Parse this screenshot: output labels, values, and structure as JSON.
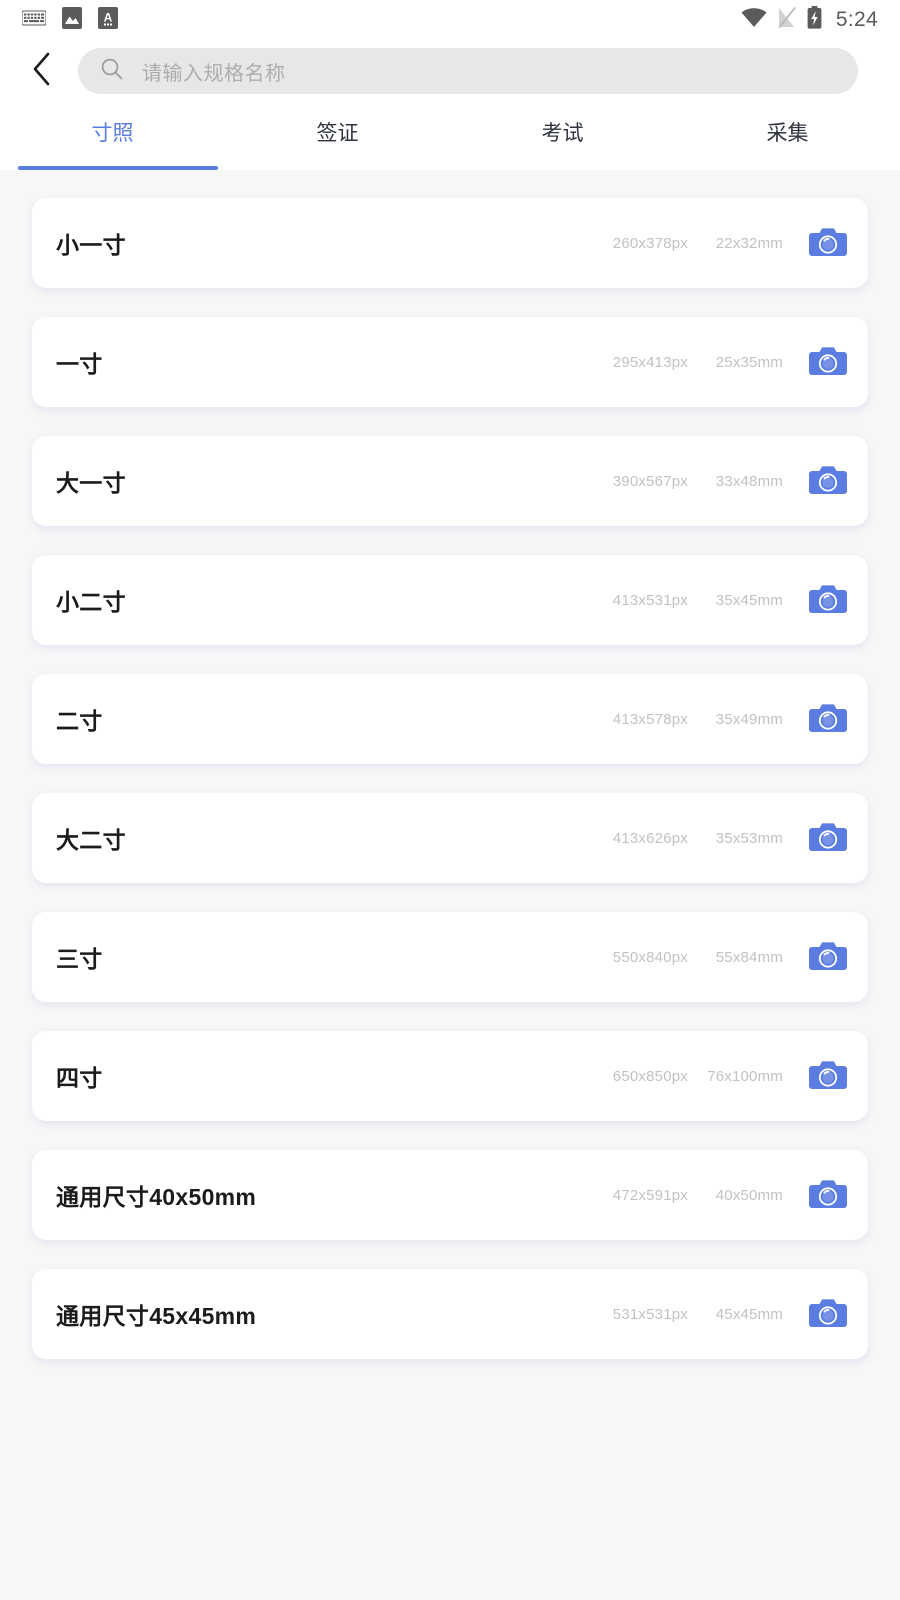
{
  "statusbar": {
    "time": "5:24",
    "left_icons": [
      "keyboard-icon",
      "image-icon",
      "letter-a-icon"
    ],
    "right_icons": [
      "wifi-icon",
      "no-signal-icon",
      "battery-charging-icon"
    ]
  },
  "header": {
    "back_icon": "chevron-left-icon",
    "search": {
      "icon": "search-icon",
      "value": "",
      "placeholder": "请输入规格名称"
    }
  },
  "tabs": {
    "active_index": 0,
    "items": [
      {
        "label": "寸照"
      },
      {
        "label": "签证"
      },
      {
        "label": "考试"
      },
      {
        "label": "采集"
      }
    ]
  },
  "colors": {
    "accent": "#5b7ce0",
    "page_bg": "#f7f7f7",
    "card_bg": "#ffffff",
    "muted_text": "#c2c2c2",
    "search_bg": "#e7e7e7"
  },
  "list": {
    "camera_icon": "camera-icon",
    "items": [
      {
        "name": "小一寸",
        "px": "260x378px",
        "mm": "22x32mm"
      },
      {
        "name": "一寸",
        "px": "295x413px",
        "mm": "25x35mm"
      },
      {
        "name": "大一寸",
        "px": "390x567px",
        "mm": "33x48mm"
      },
      {
        "name": "小二寸",
        "px": "413x531px",
        "mm": "35x45mm"
      },
      {
        "name": "二寸",
        "px": "413x578px",
        "mm": "35x49mm"
      },
      {
        "name": "大二寸",
        "px": "413x626px",
        "mm": "35x53mm"
      },
      {
        "name": "三寸",
        "px": "550x840px",
        "mm": "55x84mm"
      },
      {
        "name": "四寸",
        "px": "650x850px",
        "mm": "76x100mm"
      },
      {
        "name": "通用尺寸40x50mm",
        "px": "472x591px",
        "mm": "40x50mm"
      },
      {
        "name": "通用尺寸45x45mm",
        "px": "531x531px",
        "mm": "45x45mm"
      }
    ]
  }
}
